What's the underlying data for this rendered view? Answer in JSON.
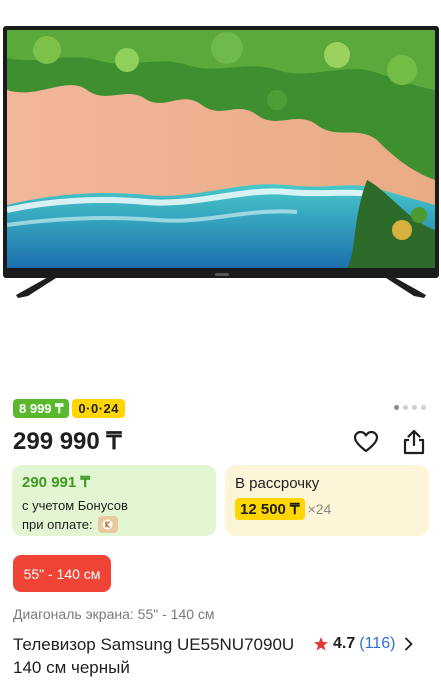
{
  "gallery": {
    "image_alt": "Samsung TV with beach aerial view",
    "page_count": 4,
    "active_page": 1
  },
  "badges": {
    "monthly_payment": "8 999 ₸",
    "installment_plan": "0·0·24"
  },
  "price": "299 990 ₸",
  "bonus_card": {
    "price": "290 991 ₸",
    "line1": "с учетом Бонусов",
    "line2": "при оплате:"
  },
  "installment_card": {
    "title": "В рассрочку",
    "amount": "12 500 ₸",
    "months": "×24"
  },
  "size_chip": "55\" - 140 см",
  "spec_line": "Диагональ экрана: 55\" - 140 см",
  "product_title": "Телевизор Samsung UE55NU7090U 140 см черный",
  "rating": {
    "value": "4.7",
    "count": "(116)"
  },
  "colors": {
    "accent_red": "#f04437",
    "bonus_green": "#3d9a1d",
    "kaspi_yellow": "#ffd600",
    "link_blue": "#2f6fd6"
  },
  "icons": {
    "favorite": "heart-icon",
    "share": "share-icon",
    "rating": "star-icon",
    "more": "chevron-right-icon"
  }
}
